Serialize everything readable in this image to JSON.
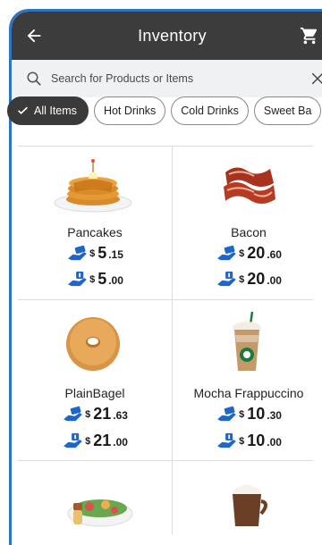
{
  "header": {
    "title": "Inventory"
  },
  "search": {
    "placeholder": "Search for Products or Items"
  },
  "chips": [
    {
      "label": "All Items",
      "active": true
    },
    {
      "label": "Hot Drinks"
    },
    {
      "label": "Cold Drinks"
    },
    {
      "label": "Sweet Ba"
    }
  ],
  "products": [
    {
      "name": "Pancakes",
      "sell": {
        "currency": "$",
        "whole": "5",
        "cents": ".15"
      },
      "cost": {
        "currency": "$",
        "whole": "5",
        "cents": ".00"
      }
    },
    {
      "name": "Bacon",
      "sell": {
        "currency": "$",
        "whole": "20",
        "cents": ".60"
      },
      "cost": {
        "currency": "$",
        "whole": "20",
        "cents": ".00"
      }
    },
    {
      "name": "PlainBagel",
      "sell": {
        "currency": "$",
        "whole": "21",
        "cents": ".63"
      },
      "cost": {
        "currency": "$",
        "whole": "21",
        "cents": ".00"
      }
    },
    {
      "name": "Mocha Frappuccino",
      "sell": {
        "currency": "$",
        "whole": "10",
        "cents": ".30"
      },
      "cost": {
        "currency": "$",
        "whole": "10",
        "cents": ".00"
      }
    }
  ],
  "colors": {
    "header": "#3c3c3c",
    "accent": "#1e66c8",
    "frame": "#2f74c0"
  }
}
